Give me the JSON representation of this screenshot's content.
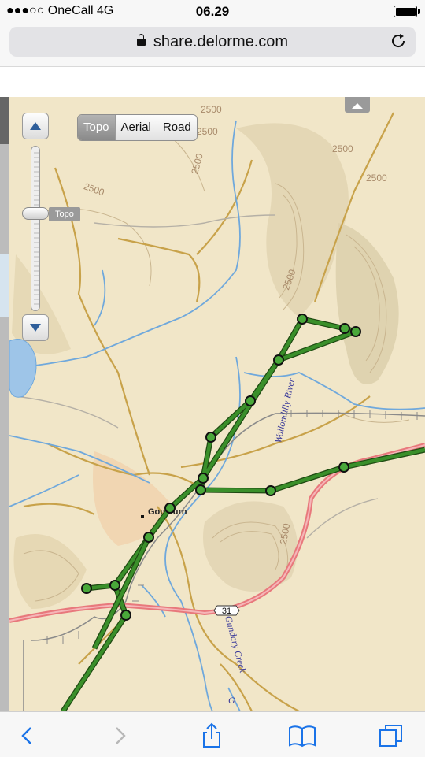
{
  "status_bar": {
    "carrier": "●●●○○ OneCall  4G",
    "time": "06.29"
  },
  "browser": {
    "url": "share.delorme.com"
  },
  "map": {
    "map_types": [
      {
        "label": "Topo",
        "active": true
      },
      {
        "label": "Aerial",
        "active": false
      },
      {
        "label": "Road",
        "active": false
      }
    ],
    "zoom_tooltip": "Topo",
    "place_labels": {
      "town": "Goulburn",
      "river": "Wollondilly River",
      "creek": "Gundary Creek",
      "highway": "31"
    },
    "contour_labels": [
      "2500",
      "2500",
      "2500",
      "2500",
      "2500",
      "2500",
      "2500",
      "2500"
    ],
    "colors": {
      "track": "#3a8f2a",
      "track_outline": "#1f4a12",
      "highway": "#e8787c",
      "water": "#6fa8dc",
      "road": "#c8a24a",
      "terrain": "#f1e6c8"
    }
  }
}
